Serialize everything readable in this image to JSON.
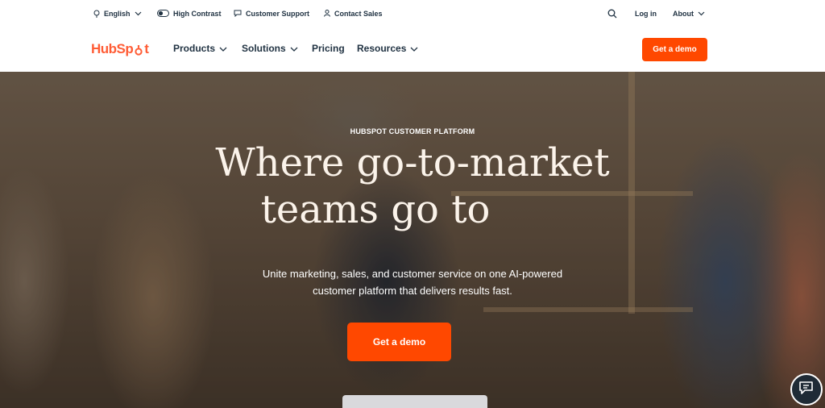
{
  "utility_bar": {
    "language": "English",
    "high_contrast": "High Contrast",
    "customer_support": "Customer Support",
    "contact_sales": "Contact Sales",
    "login": "Log in",
    "about": "About"
  },
  "nav": {
    "logo_text_1": "HubSp",
    "logo_text_2": "t",
    "items": [
      {
        "label": "Products",
        "has_dropdown": true
      },
      {
        "label": "Solutions",
        "has_dropdown": true
      },
      {
        "label": "Pricing",
        "has_dropdown": false
      },
      {
        "label": "Resources",
        "has_dropdown": true
      }
    ],
    "cta": "Get a demo"
  },
  "hero": {
    "eyebrow": "HUBSPOT CUSTOMER PLATFORM",
    "title_line1": "Where go-to-market",
    "title_line2": "teams go to",
    "subtitle_line1": "Unite marketing, sales, and customer service on one AI-powered",
    "subtitle_line2": "customer platform that delivers results fast.",
    "cta": "Get a demo"
  },
  "colors": {
    "brand": "#ff5c35",
    "cta": "#ff4800",
    "text": "#213343",
    "chat": "#1f2b36"
  },
  "icons": [
    "globe-icon",
    "contrast-toggle-icon",
    "support-icon",
    "person-icon",
    "search-icon",
    "chevron-down-icon",
    "chat-icon"
  ]
}
